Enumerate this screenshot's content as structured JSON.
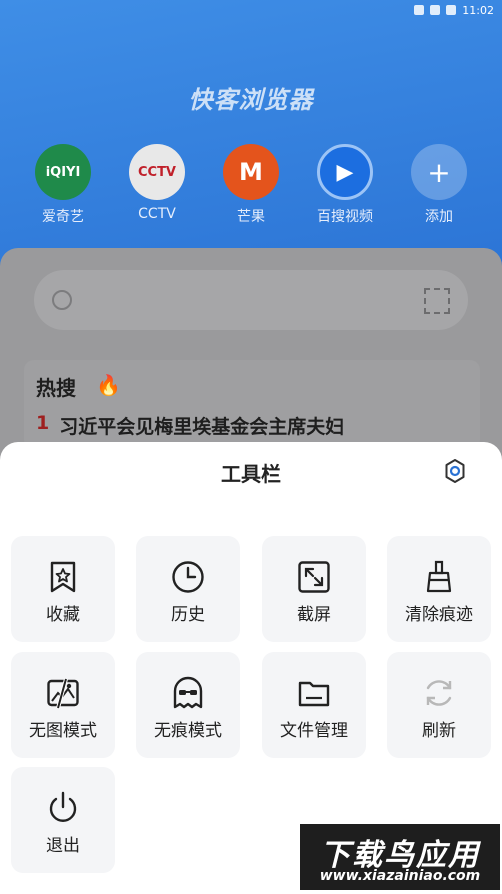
{
  "status_bar": {
    "time": "11:02"
  },
  "browser": {
    "title": "快客浏览器"
  },
  "shortcuts": [
    {
      "label": "爱奇艺",
      "logo_text": "iQIYI"
    },
    {
      "label": "CCTV",
      "logo_text": "CCTV"
    },
    {
      "label": "芒果",
      "logo_text": "M"
    },
    {
      "label": "百搜视频",
      "logo_text": "▶"
    },
    {
      "label": "添加",
      "logo_text": "+"
    }
  ],
  "hot_search": {
    "title": "热搜",
    "items": [
      {
        "rank": "1",
        "text": "习近平会见梅里埃基金会主席夫妇"
      }
    ]
  },
  "toolbar": {
    "title": "工具栏",
    "items": [
      {
        "label": "收藏",
        "icon": "bookmark-star-icon"
      },
      {
        "label": "历史",
        "icon": "clock-icon"
      },
      {
        "label": "截屏",
        "icon": "screenshot-icon"
      },
      {
        "label": "清除痕迹",
        "icon": "broom-icon"
      },
      {
        "label": "无图模式",
        "icon": "no-image-icon"
      },
      {
        "label": "无痕模式",
        "icon": "incognito-ghost-icon"
      },
      {
        "label": "文件管理",
        "icon": "folder-icon"
      },
      {
        "label": "刷新",
        "icon": "refresh-icon"
      },
      {
        "label": "退出",
        "icon": "power-icon"
      }
    ]
  },
  "watermark": {
    "line1": "下载鸟应用",
    "line2": "www.xiazainiao.com"
  },
  "colors": {
    "accent": "#2a72d4",
    "tile_bg": "#f4f5f7",
    "rank_red": "#9e1f1f"
  }
}
